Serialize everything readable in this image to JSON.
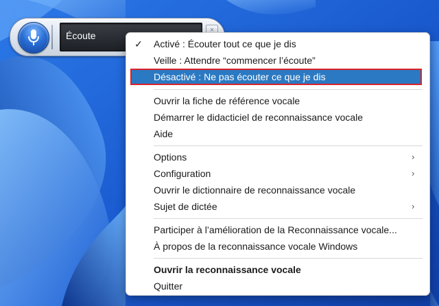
{
  "speech_bar": {
    "status": "Écoute",
    "close_glyph": "×"
  },
  "menu": {
    "items": [
      {
        "label": "Activé : Écouter tout ce que je dis",
        "checked": true
      },
      {
        "label": "Veille : Attendre “commencer l’écoute”"
      },
      {
        "label": "Désactivé : Ne pas écouter ce que je dis",
        "highlighted": true
      },
      {
        "label": "Ouvrir la fiche de référence vocale"
      },
      {
        "label": "Démarrer le didacticiel de reconnaissance vocale"
      },
      {
        "label": "Aide"
      },
      {
        "label": "Options",
        "submenu": true
      },
      {
        "label": "Configuration",
        "submenu": true
      },
      {
        "label": "Ouvrir le dictionnaire de reconnaissance vocale"
      },
      {
        "label": "Sujet de dictée",
        "submenu": true
      },
      {
        "label": "Participer à l’amélioration de la Reconnaissance vocale..."
      },
      {
        "label": "À propos de la reconnaissance vocale Windows"
      },
      {
        "label": "Ouvrir la reconnaissance vocale",
        "bold": true
      },
      {
        "label": "Quitter"
      }
    ],
    "check_glyph": "✓",
    "submenu_glyph": "›"
  },
  "colors": {
    "highlight": "#2b79c2",
    "annotation_box": "#d9232a",
    "wallpaper": "#1a5fd4"
  }
}
